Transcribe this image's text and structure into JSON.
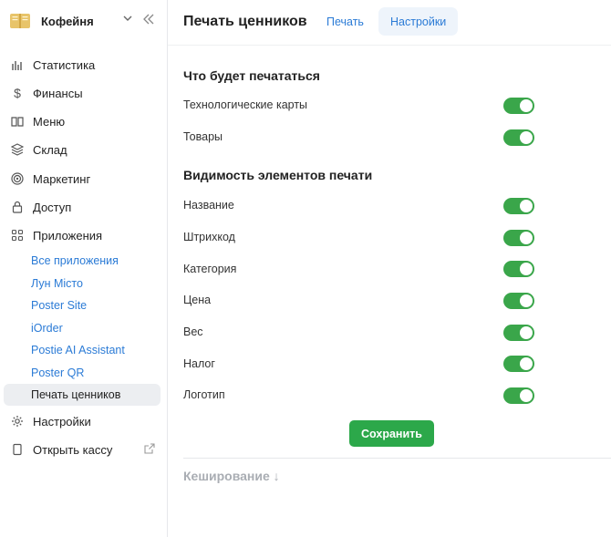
{
  "brand": {
    "name": "Кофейня",
    "logo_icon": "book-logo-icon"
  },
  "sidebar": {
    "items": [
      {
        "label": "Статистика",
        "icon": "bar-chart-icon"
      },
      {
        "label": "Финансы",
        "icon": "dollar-icon"
      },
      {
        "label": "Меню",
        "icon": "open-book-icon"
      },
      {
        "label": "Склад",
        "icon": "layers-icon"
      },
      {
        "label": "Маркетинг",
        "icon": "target-icon"
      },
      {
        "label": "Доступ",
        "icon": "lock-icon"
      },
      {
        "label": "Приложения",
        "icon": "grid-icon"
      }
    ],
    "apps": [
      "Все приложения",
      "Лун Місто",
      "Poster Site",
      "iOrder",
      "Postie AI Assistant",
      "Poster QR",
      "Печать ценников"
    ],
    "active_app": "Печать ценников",
    "settings": {
      "label": "Настройки",
      "icon": "gear-icon"
    },
    "open_register": {
      "label": "Открыть кассу",
      "icon": "tablet-icon"
    }
  },
  "header": {
    "title": "Печать ценников",
    "tabs": [
      "Печать",
      "Настройки"
    ],
    "active_tab": "Настройки"
  },
  "print_section": {
    "title": "Что будет печататься",
    "rows": [
      {
        "label": "Технологические карты",
        "on": true
      },
      {
        "label": "Товары",
        "on": true
      }
    ]
  },
  "visibility_section": {
    "title": "Видимость элементов печати",
    "rows": [
      {
        "label": "Название",
        "on": true
      },
      {
        "label": "Штрихкод",
        "on": true
      },
      {
        "label": "Категория",
        "on": true
      },
      {
        "label": "Цена",
        "on": true
      },
      {
        "label": "Вес",
        "on": true
      },
      {
        "label": "Налог",
        "on": true
      },
      {
        "label": "Логотип",
        "on": true
      }
    ]
  },
  "save_label": "Сохранить",
  "cache_title": "Кеширование ↓",
  "colors": {
    "accent": "#2b7bd6",
    "toggle_on": "#3aa64a",
    "save": "#2ca84a"
  }
}
